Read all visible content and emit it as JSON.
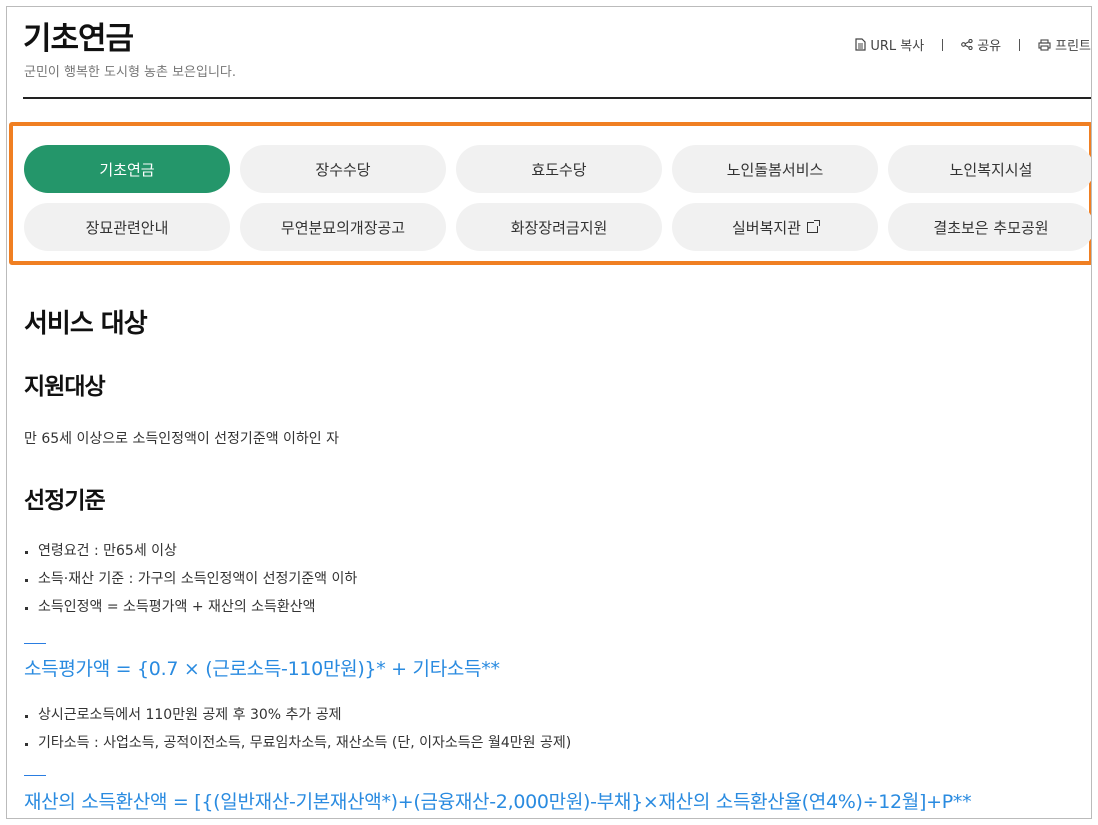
{
  "header": {
    "title": "기초연금",
    "subtitle": "군민이 행복한 도시형 농촌 보은입니다."
  },
  "tools": {
    "url_copy": "URL 복사",
    "share": "공유",
    "print": "프린트"
  },
  "tabs": [
    {
      "label": "기초연금",
      "active": true
    },
    {
      "label": "장수수당"
    },
    {
      "label": "효도수당"
    },
    {
      "label": "노인돌봄서비스"
    },
    {
      "label": "노인복지시설"
    },
    {
      "label": "장묘관련안내"
    },
    {
      "label": "무연분묘의개장공고"
    },
    {
      "label": "화장장려금지원"
    },
    {
      "label": "실버복지관",
      "external": true
    },
    {
      "label": "결초보은 추모공원"
    }
  ],
  "main": {
    "section_title": "서비스 대상",
    "target": {
      "heading": "지원대상",
      "text": "만 65세 이상으로 소득인정액이 선정기준액 이하인 자"
    },
    "criteria": {
      "heading": "선정기준",
      "items": [
        "연령요건 : 만65세 이상",
        "소득·재산 기준 : 가구의 소득인정액이 선정기준액 이하",
        "소득인정액 = 소득평가액 + 재산의 소득환산액"
      ],
      "formula1": "소득평가액 = {0.7 × (근로소득-110만원)}* + 기타소득**",
      "notes1": [
        "상시근로소득에서 110만원 공제 후 30% 추가 공제",
        "기타소득 : 사업소득, 공적이전소득, 무료임차소득, 재산소득 (단, 이자소득은 월4만원 공제)"
      ],
      "formula2": "재산의 소득환산액 = [{(일반재산-기본재산액*)+(금융재산-2,000만원)-부채}×재산의 소득환산율(연4%)÷12월]+P**"
    }
  },
  "colors": {
    "active_tab": "#24966a",
    "highlight_border": "#f07f22",
    "formula_text": "#2a8be0"
  }
}
